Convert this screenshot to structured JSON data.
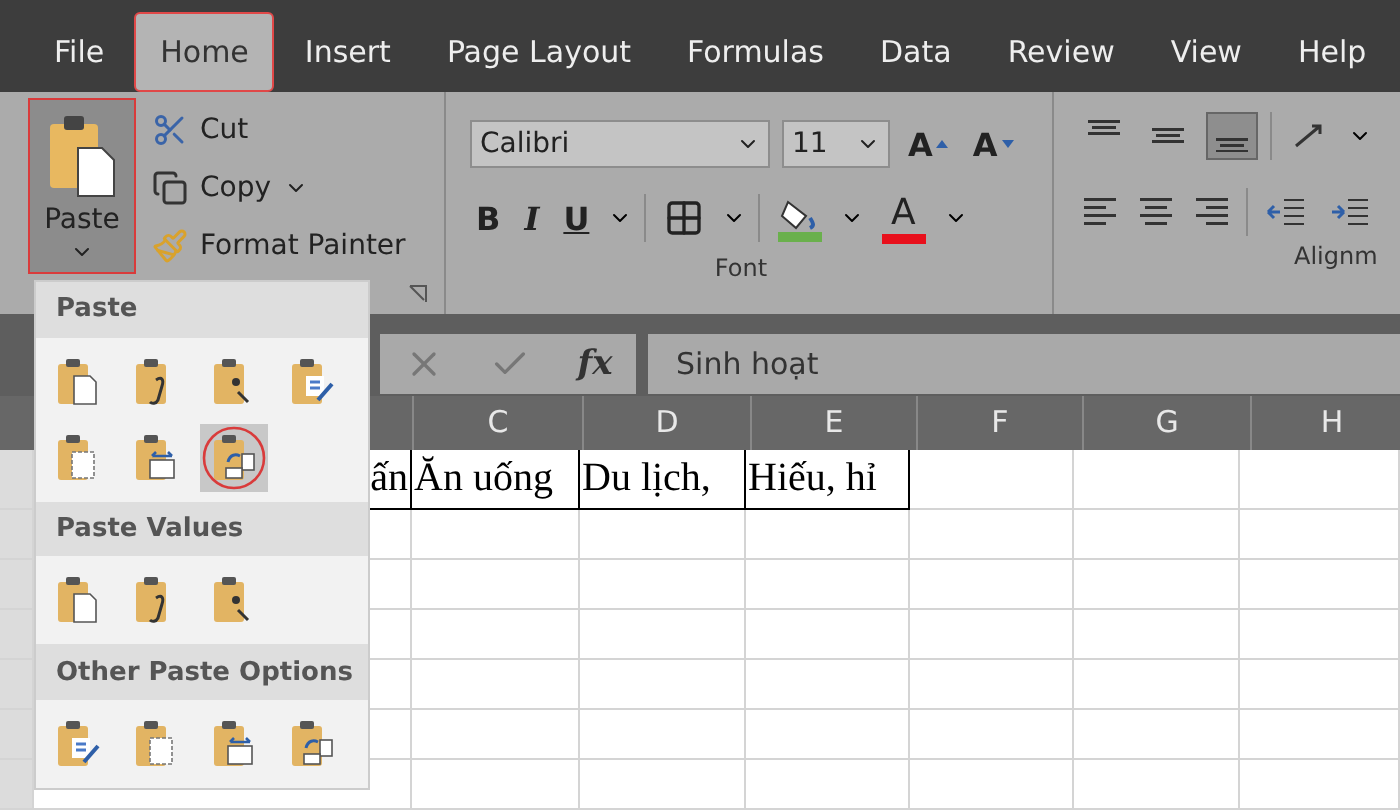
{
  "tabs": [
    {
      "label": "File",
      "selected": false
    },
    {
      "label": "Home",
      "selected": true
    },
    {
      "label": "Insert",
      "selected": false
    },
    {
      "label": "Page Layout",
      "selected": false
    },
    {
      "label": "Formulas",
      "selected": false
    },
    {
      "label": "Data",
      "selected": false
    },
    {
      "label": "Review",
      "selected": false
    },
    {
      "label": "View",
      "selected": false
    },
    {
      "label": "Help",
      "selected": false
    }
  ],
  "clipboard": {
    "paste": {
      "label": "Paste",
      "selected": true
    },
    "actions": [
      {
        "label": "Cut",
        "kind": "cut"
      },
      {
        "label": "Copy",
        "kind": "copy"
      },
      {
        "label": "Format Painter",
        "kind": "painter"
      }
    ]
  },
  "font": {
    "name": "Calibri",
    "size": "11",
    "grow_label": "A",
    "shrink_label": "A",
    "styles": [
      "B",
      "I",
      "U"
    ],
    "color_label": "A",
    "group_label": "Font"
  },
  "alignment": {
    "vertical": [
      {
        "selected": false
      },
      {
        "selected": false
      },
      {
        "selected": true
      }
    ],
    "group_label": "Alignm"
  },
  "formula_bar": {
    "fx": "fx",
    "value": "Sinh hoạt"
  },
  "columns": [
    "C",
    "D",
    "E",
    "F",
    "G",
    "H"
  ],
  "first_row": {
    "cells": [
      "ấn",
      "Ăn uống",
      "Du lịch,",
      "Hiếu, hỉ"
    ]
  },
  "paste_menu": {
    "sections": [
      {
        "title": "Paste",
        "options": [
          {
            "selected": false
          },
          {
            "selected": false
          },
          {
            "selected": false
          },
          {
            "selected": false
          },
          {
            "selected": false
          },
          {
            "selected": false
          },
          {
            "selected": true
          }
        ]
      },
      {
        "title": "Paste Values",
        "options": [
          {
            "selected": false
          },
          {
            "selected": false
          },
          {
            "selected": false
          }
        ]
      },
      {
        "title": "Other Paste Options",
        "options": [
          {
            "selected": false
          },
          {
            "selected": false
          },
          {
            "selected": false
          },
          {
            "selected": false
          }
        ]
      }
    ]
  }
}
